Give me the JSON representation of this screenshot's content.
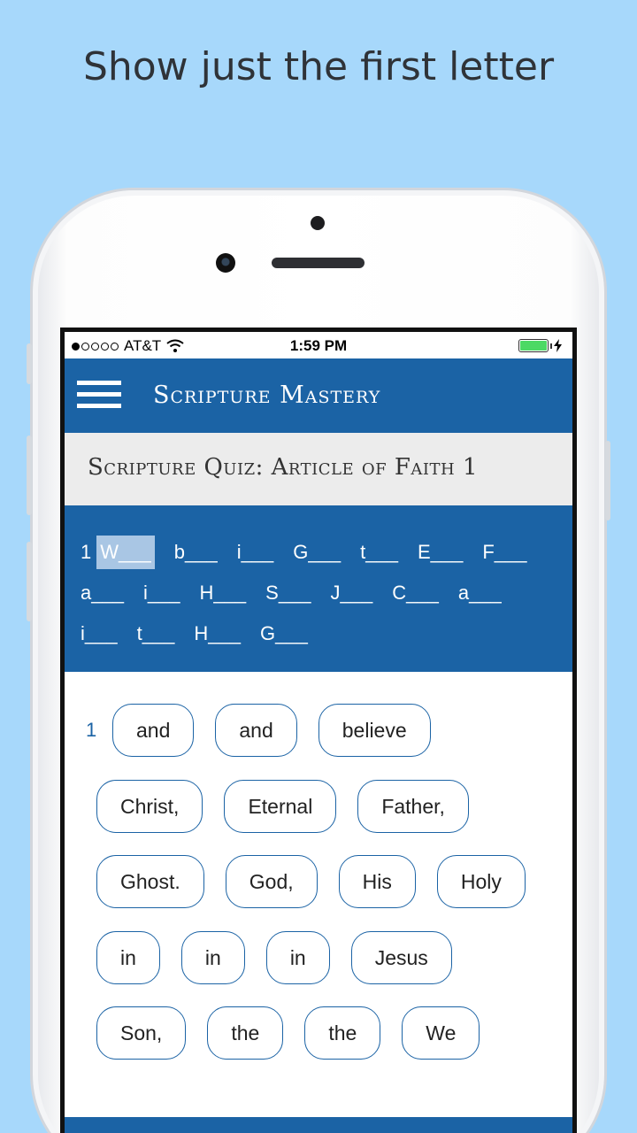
{
  "promo": {
    "caption": "Show just the first letter"
  },
  "status": {
    "carrier": "AT&T",
    "time": "1:59 PM",
    "signal_bars_filled": 1,
    "signal_bars_total": 5,
    "battery_level": 1.0
  },
  "app": {
    "title": "Scripture Mastery"
  },
  "quiz": {
    "title": "Scripture Quiz: Article of Faith 1"
  },
  "verse": {
    "number": "1",
    "lines": [
      [
        "W___",
        "b___",
        "i___",
        "G___",
        "t___",
        "E___",
        "F___"
      ],
      [
        "a___",
        "i___",
        "H___",
        "S___",
        "J___",
        "C___",
        "a___"
      ],
      [
        "i___",
        "t___",
        "H___",
        "G___"
      ]
    ]
  },
  "word_bank": {
    "number": "1",
    "rows": [
      [
        "and",
        "and",
        "believe"
      ],
      [
        "Christ,",
        "Eternal",
        "Father,"
      ],
      [
        "Ghost.",
        "God,",
        "His",
        "Holy"
      ],
      [
        "in",
        "in",
        "in",
        "Jesus"
      ],
      [
        "Son,",
        "the",
        "the",
        "We"
      ]
    ]
  },
  "colors": {
    "brand": "#1b63a5",
    "background": "#a7d8fb",
    "highlight": "#a9c6e4"
  }
}
